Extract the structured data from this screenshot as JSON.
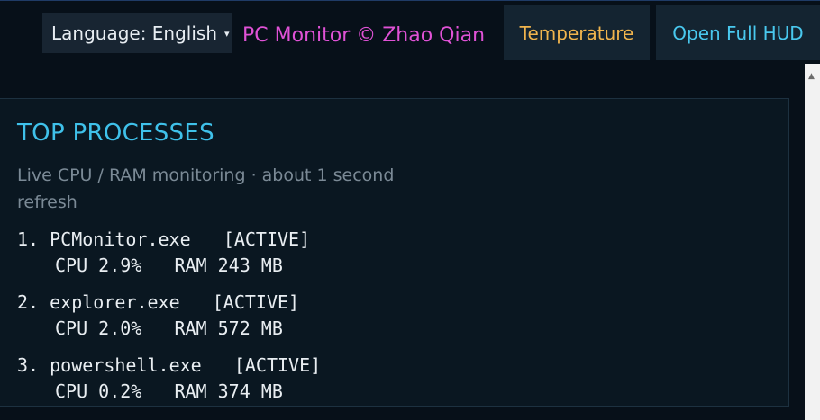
{
  "toolbar": {
    "language_label": "Language: English",
    "language_caret": "▾",
    "brand": "PC Monitor © Zhao Qian",
    "temperature_label": "Temperature",
    "hud_label": "Open Full HUD"
  },
  "panel": {
    "title": "TOP PROCESSES",
    "subtitle": "Live CPU / RAM monitoring · about 1 second refresh"
  },
  "processes": [
    {
      "rank": "1.",
      "name": "PCMonitor.exe",
      "status": "[ACTIVE]",
      "cpu_label": "CPU",
      "cpu": "2.9%",
      "ram_label": "RAM",
      "ram": "243 MB"
    },
    {
      "rank": "2.",
      "name": "explorer.exe",
      "status": "[ACTIVE]",
      "cpu_label": "CPU",
      "cpu": "2.0%",
      "ram_label": "RAM",
      "ram": "572 MB"
    },
    {
      "rank": "3.",
      "name": "powershell.exe",
      "status": "[ACTIVE]",
      "cpu_label": "CPU",
      "cpu": "0.2%",
      "ram_label": "RAM",
      "ram": "374 MB"
    }
  ],
  "scrollbar": {
    "up_arrow": "▲"
  },
  "colors": {
    "background": "#071019",
    "accent_blue": "#3fc1ea",
    "brand_magenta": "#e052d6",
    "temperature_orange": "#f0b44d"
  }
}
